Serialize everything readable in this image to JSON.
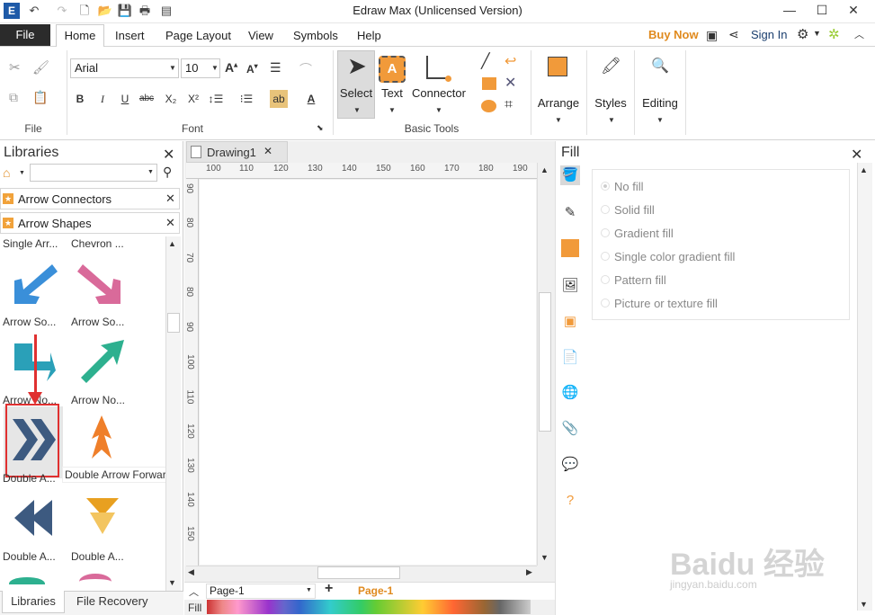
{
  "app": {
    "title": "Edraw Max (Unlicensed Version)"
  },
  "tabs": {
    "file": "File",
    "home": "Home",
    "insert": "Insert",
    "page_layout": "Page Layout",
    "view": "View",
    "symbols": "Symbols",
    "help": "Help"
  },
  "account": {
    "buy_now": "Buy Now",
    "sign_in": "Sign In"
  },
  "ribbon": {
    "font_name": "Arial",
    "font_size": "10",
    "groups": {
      "file": "File",
      "font": "Font",
      "basic_tools": "Basic Tools"
    },
    "buttons": {
      "select": "Select",
      "text": "Text",
      "connector": "Connector",
      "arrange": "Arrange",
      "styles": "Styles",
      "editing": "Editing"
    },
    "format_btns": {
      "bold": "B",
      "italic": "I",
      "underline": "U",
      "strike": "abc",
      "subscript": "X₂",
      "superscript": "X²"
    }
  },
  "libraries": {
    "title": "Libraries",
    "search_placeholder": "",
    "categories": [
      {
        "label": "Arrow Connectors"
      },
      {
        "label": "Arrow Shapes"
      }
    ],
    "shapes": [
      {
        "label": "Single Arr...",
        "color": "#3a8fd9"
      },
      {
        "label": "Chevron ...",
        "color": "#d96a9a"
      },
      {
        "label": "Arrow So...",
        "color": "#3a8fd9"
      },
      {
        "label": "Arrow So...",
        "color": "#d96a9a"
      },
      {
        "label": "Arrow No...",
        "color": "#2aa0b8"
      },
      {
        "label": "Arrow No...",
        "color": "#2db08f"
      },
      {
        "label": "Double A...",
        "color": "#3d5a80"
      },
      {
        "label": "Double Arrow Forward",
        "color": "#ef7f2a"
      },
      {
        "label": "Double A...",
        "color": "#3d5a80"
      },
      {
        "label": "Double A...",
        "color": "#e8a020"
      }
    ],
    "bottom_tabs": {
      "libraries": "Libraries",
      "file_recovery": "File Recovery"
    }
  },
  "document": {
    "tab": "Drawing1",
    "ruler_top": [
      "100",
      "110",
      "120",
      "130",
      "140",
      "150",
      "160",
      "170",
      "180",
      "190"
    ],
    "ruler_left": [
      "90",
      "80",
      "70",
      "80",
      "90",
      "100",
      "110",
      "120",
      "130",
      "140",
      "150"
    ]
  },
  "pages": {
    "current": "Page-1",
    "active": "Page-1",
    "fill_label": "Fill"
  },
  "fill": {
    "title": "Fill",
    "options": [
      "No fill",
      "Solid fill",
      "Gradient fill",
      "Single color gradient fill",
      "Pattern fill",
      "Picture or texture fill"
    ]
  },
  "colors": {
    "accent": "#e08a1e",
    "highlight_box": "#e03030"
  },
  "watermark": {
    "main": "Baidu 经验",
    "sub": "jingyan.baidu.com"
  }
}
